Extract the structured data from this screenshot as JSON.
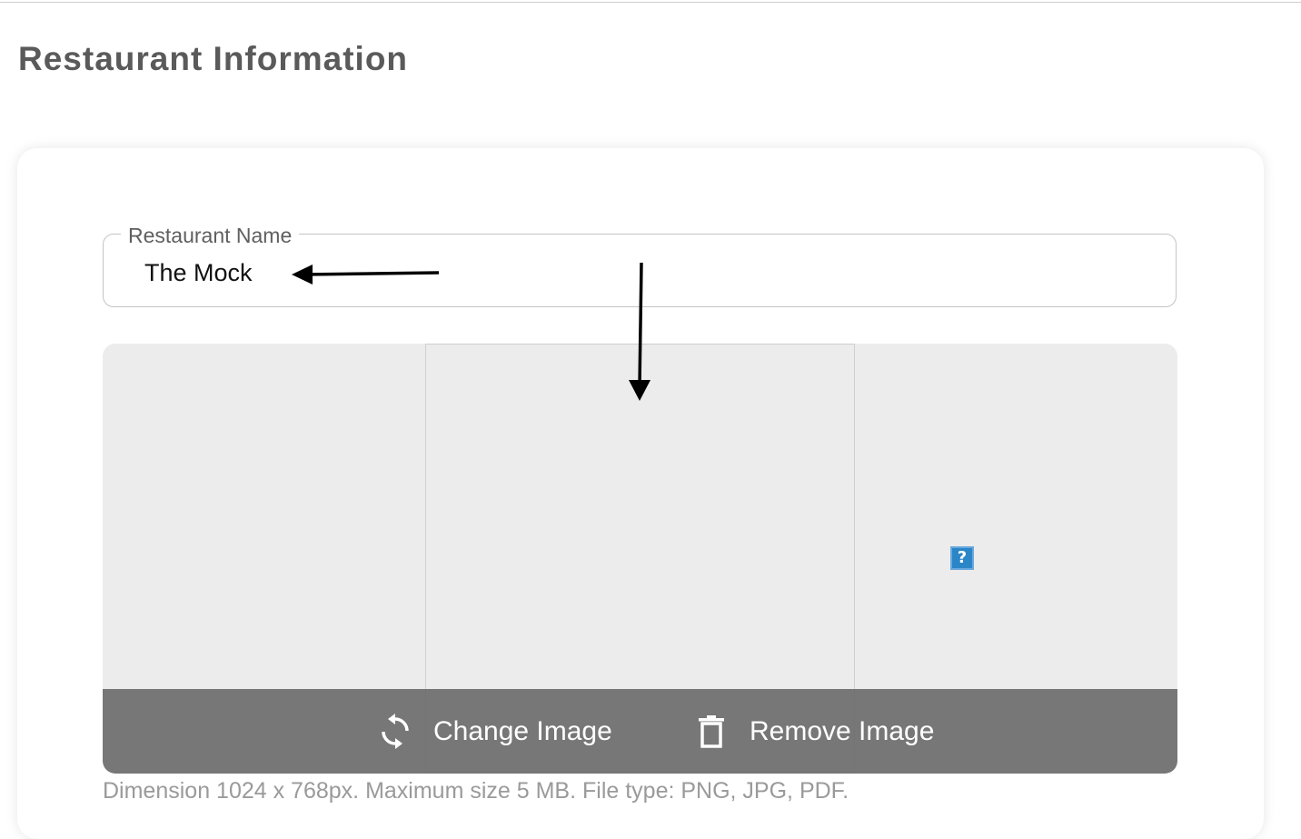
{
  "page": {
    "title": "Restaurant Information"
  },
  "restaurant_name": {
    "label": "Restaurant Name",
    "value": "The Mock"
  },
  "image_upload": {
    "broken_image_glyph": "?",
    "change_label": "Change Image",
    "remove_label": "Remove Image",
    "change_icon": "refresh-icon",
    "remove_icon": "trash-icon",
    "helper_text": "Dimension 1024 x 768px. Maximum size 5 MB. File type: PNG, JPG, PDF."
  },
  "colors": {
    "title": "#5a5a5a",
    "action_bar": "#6e6e6e",
    "image_bg": "#ececec",
    "helper_text": "#9a9a9a",
    "annotation_arrows": "#000000"
  }
}
